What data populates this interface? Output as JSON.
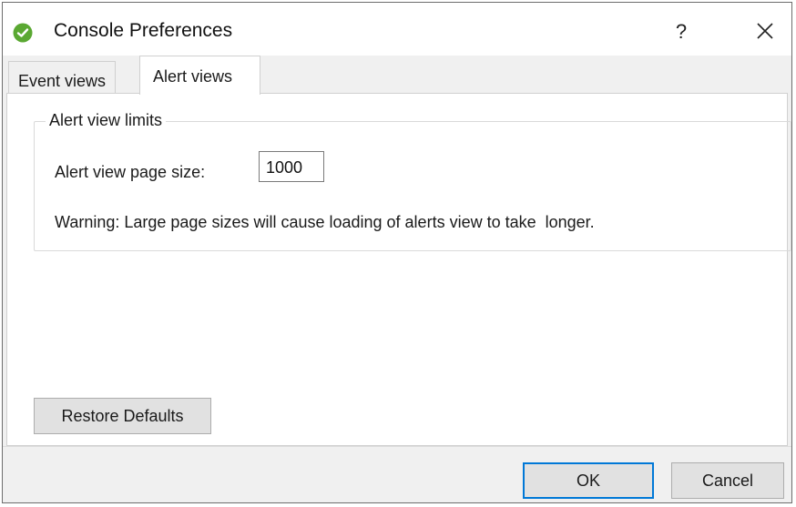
{
  "window": {
    "title": "Console Preferences",
    "help_label": "?",
    "accent_color": "#0078d7",
    "app_icon": "green-check-badge-icon"
  },
  "tabs": [
    {
      "label": "Event views",
      "selected": false
    },
    {
      "label": "Alert views",
      "selected": true
    }
  ],
  "alert_view_limits": {
    "group_title": "Alert view limits",
    "page_size_label": "Alert view page size:",
    "page_size_value": "1000",
    "warning": "Warning: Large page sizes will cause loading of alerts view to take  longer."
  },
  "buttons": {
    "restore_defaults": "Restore Defaults",
    "ok": "OK",
    "cancel": "Cancel"
  }
}
